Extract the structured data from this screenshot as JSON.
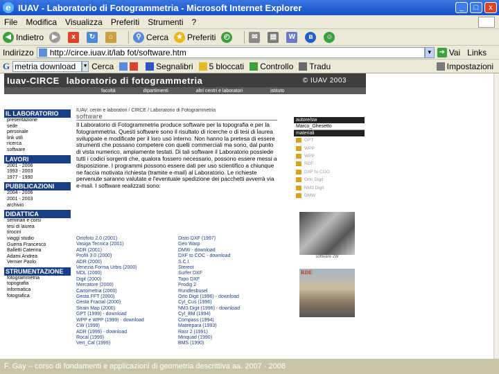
{
  "window": {
    "title": "IUAV - Laboratorio di Fotogrammetria - Microsoft Internet Explorer",
    "btn_min": "_",
    "btn_max": "□",
    "btn_close": "x"
  },
  "menu": [
    "File",
    "Modifica",
    "Visualizza",
    "Preferiti",
    "Strumenti",
    "?"
  ],
  "toolbar": {
    "back": "Indietro",
    "search": "Cerca",
    "favorites": "Preferiti"
  },
  "address": {
    "label": "Indirizzo",
    "url": "http://circe.iuav.it/lab fot/software.htm",
    "go": "Vai",
    "links": "Links"
  },
  "googlebar": {
    "logo": "G",
    "query": "metria download",
    "search": "Cerca",
    "bookmarks": "Segnalibri",
    "blocked": "5 bloccati",
    "check": "Controllo",
    "translate": "Tradu",
    "settings": "Impostazioni"
  },
  "site": {
    "banner_left": "Iuav-CIRCE",
    "banner_title": "laboratorio di fotogrammetria",
    "banner_right": "© IUAV 2003",
    "nav": [
      "facoltà",
      "dipartimenti",
      "altri centri e laboratori",
      "istituto"
    ],
    "sidebar": [
      {
        "section": "IL LABORATORIO",
        "items": [
          "presentazione",
          "sede",
          "personale",
          "link utili",
          "ricerca",
          "software"
        ]
      },
      {
        "section": "LAVORI",
        "items": [
          "2001 - 2006",
          "1993 - 2003",
          "1977 - 1990"
        ]
      },
      {
        "section": "PUBBLICAZIONI",
        "items": [
          "2004 - 2006",
          "2001 - 2003",
          "archivio"
        ]
      },
      {
        "section": "DIDATTICA",
        "items": [
          "seminari e corsi",
          "tesi di laurea",
          "tirocini",
          "viaggi studio",
          "Guerra Francesco",
          "Balletti Caterina",
          "Adami Andrea",
          "Vernier Paolo"
        ]
      },
      {
        "section": "STRUMENTAZIONE",
        "items": [
          "fotogrammetria",
          "topografia",
          "informatica",
          "fotografica"
        ]
      }
    ],
    "breadcrumb": "IUAV: centri e laboratori / CIRCE / Laboratorio di Fotogrammetria",
    "subheading": "software",
    "paragraph": "Il Laboratorio di Fotogrammetria produce software per la topografia e per la fotogrammetria. Questi software sono il risultato di ricerche o di tesi di laurea sviluppate e modificate per il loro uso interno. Non hanno la pretesa di essere strumenti che possano competere con quelli commerciali ma sono, dal punto di vista numerico, ampiamente testati. Di tali software il Laboratorio possiede tutti i codici sorgenti che, qualora fossero necessario, possono essere messi a disposizione. I programmi possono essere dati per uso scientifico a chiunque ne faccia motivata richiesta (tramite e-mail) al Laboratorio. Le richieste pervenute saranno valutate e l'eventuale spedizione dei pacchetti avverrà via e-mail. I software realizzati sono:",
    "programs_col1": [
      "Ortofoto 2.0 (2001)",
      "Vasiga Tecnica (2001)",
      "ADR (2001)",
      "Profili 3.0 (2000)",
      "ADR (2000)",
      "Venezia Forma Urbis (2000)",
      "MDL (2000)",
      "Digit (2000)",
      "Mercatore (2000)",
      "Cartometria (2000)",
      "Gesta FFT (2000)",
      "Gesta Fractal (2000)",
      "Strain Map (2000)",
      "GPT (1999) - download",
      "WPP e WPP (1999) - download",
      "CW (1999)",
      "ADR (1999) - download",
      "Rocal (1999)",
      "Vert_Cal (1999)"
    ],
    "programs_col2": [
      "Disto DXF (1997)",
      "Geo Warp",
      "DMW - download",
      "DXF to COC - download",
      "S.C.I.",
      "Stereot",
      "Surfer DXF",
      "Topo DXF",
      "Prodig 2",
      "Rundlesbusel",
      "Orto Digit (1996) - download",
      "Cyl_Cus (1996)",
      "NM3 Digit (1996) - download",
      "Cyl_BM (1994)",
      "Compass (1994)",
      "Mateepara (1993)",
      "Rasr 2 (1991)",
      "Minquad (1990)",
      "BMS (1990)"
    ],
    "right_head": "autore/sw",
    "right_sub": "Marco_Ghesetto",
    "right_mat": "materiali",
    "materials": [
      "GPT",
      "WPP",
      "WPP",
      "RDF",
      "DXF to COO",
      "Orto Digit",
      "NM3 Digit",
      "DMW"
    ],
    "pic1_caption": "software 2W",
    "pic2_label": "RDE"
  },
  "footer": "F. Gay – corso di fondamenti e applicazioni di geometria descrittiva aa. 2007 - 2008",
  "colors": {
    "title_blue": "#1550c8",
    "section_blue": "#1a3e86",
    "footer": "#c8c4a8"
  }
}
